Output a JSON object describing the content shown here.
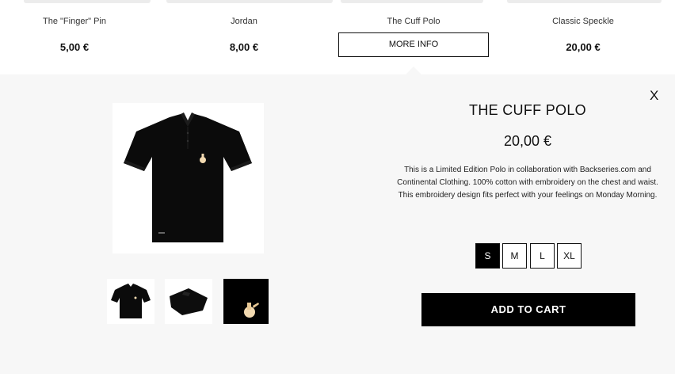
{
  "products": [
    {
      "name": "The \"Finger\" Pin",
      "price": "5,00 €"
    },
    {
      "name": "Jordan",
      "price": "8,00 €"
    },
    {
      "name": "The Cuff Polo",
      "button": "MORE INFO"
    },
    {
      "name": "Classic Speckle",
      "price": "20,00 €"
    }
  ],
  "detail": {
    "close_label": "X",
    "title": "THE CUFF POLO",
    "price": "20,00 €",
    "description": "This is a Limited Edition Polo in collaboration with Backseries.com and Continental Clothing. 100% cotton with embroidery on the chest and waist. This embroidery design fits perfect with your feelings on Monday Morning.",
    "sizes": [
      "S",
      "M",
      "L",
      "XL"
    ],
    "selected_size": "S",
    "add_to_cart": "ADD TO CART"
  },
  "colors": {
    "accent": "#000000",
    "panel_bg": "#f7f7f7"
  }
}
